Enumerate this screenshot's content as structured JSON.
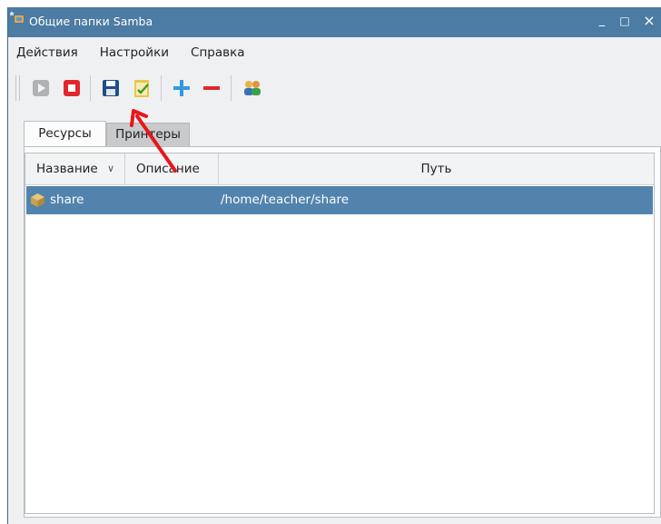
{
  "window": {
    "title": "Общие папки Samba",
    "minimize": "_",
    "maximize": "□",
    "close": "×"
  },
  "menu": {
    "items": [
      "Действия",
      "Настройки",
      "Справка"
    ]
  },
  "toolbar": {
    "buttons": [
      "start-service",
      "stop-service",
      "save",
      "apply-edit",
      "add-share",
      "remove-share",
      "users"
    ]
  },
  "tabs": [
    {
      "label": "Ресурсы",
      "active": true
    },
    {
      "label": "Принтеры",
      "active": false
    }
  ],
  "table": {
    "columns": [
      "Название",
      "Описание",
      "Путь"
    ],
    "sort_indicator": "∨",
    "rows": [
      {
        "name": "share",
        "description": "",
        "path": "/home/teacher/share",
        "selected": true
      }
    ]
  },
  "colors": {
    "titlebar": "#4c7ba3",
    "selection": "#5283ad",
    "annotation": "#e8161b"
  }
}
